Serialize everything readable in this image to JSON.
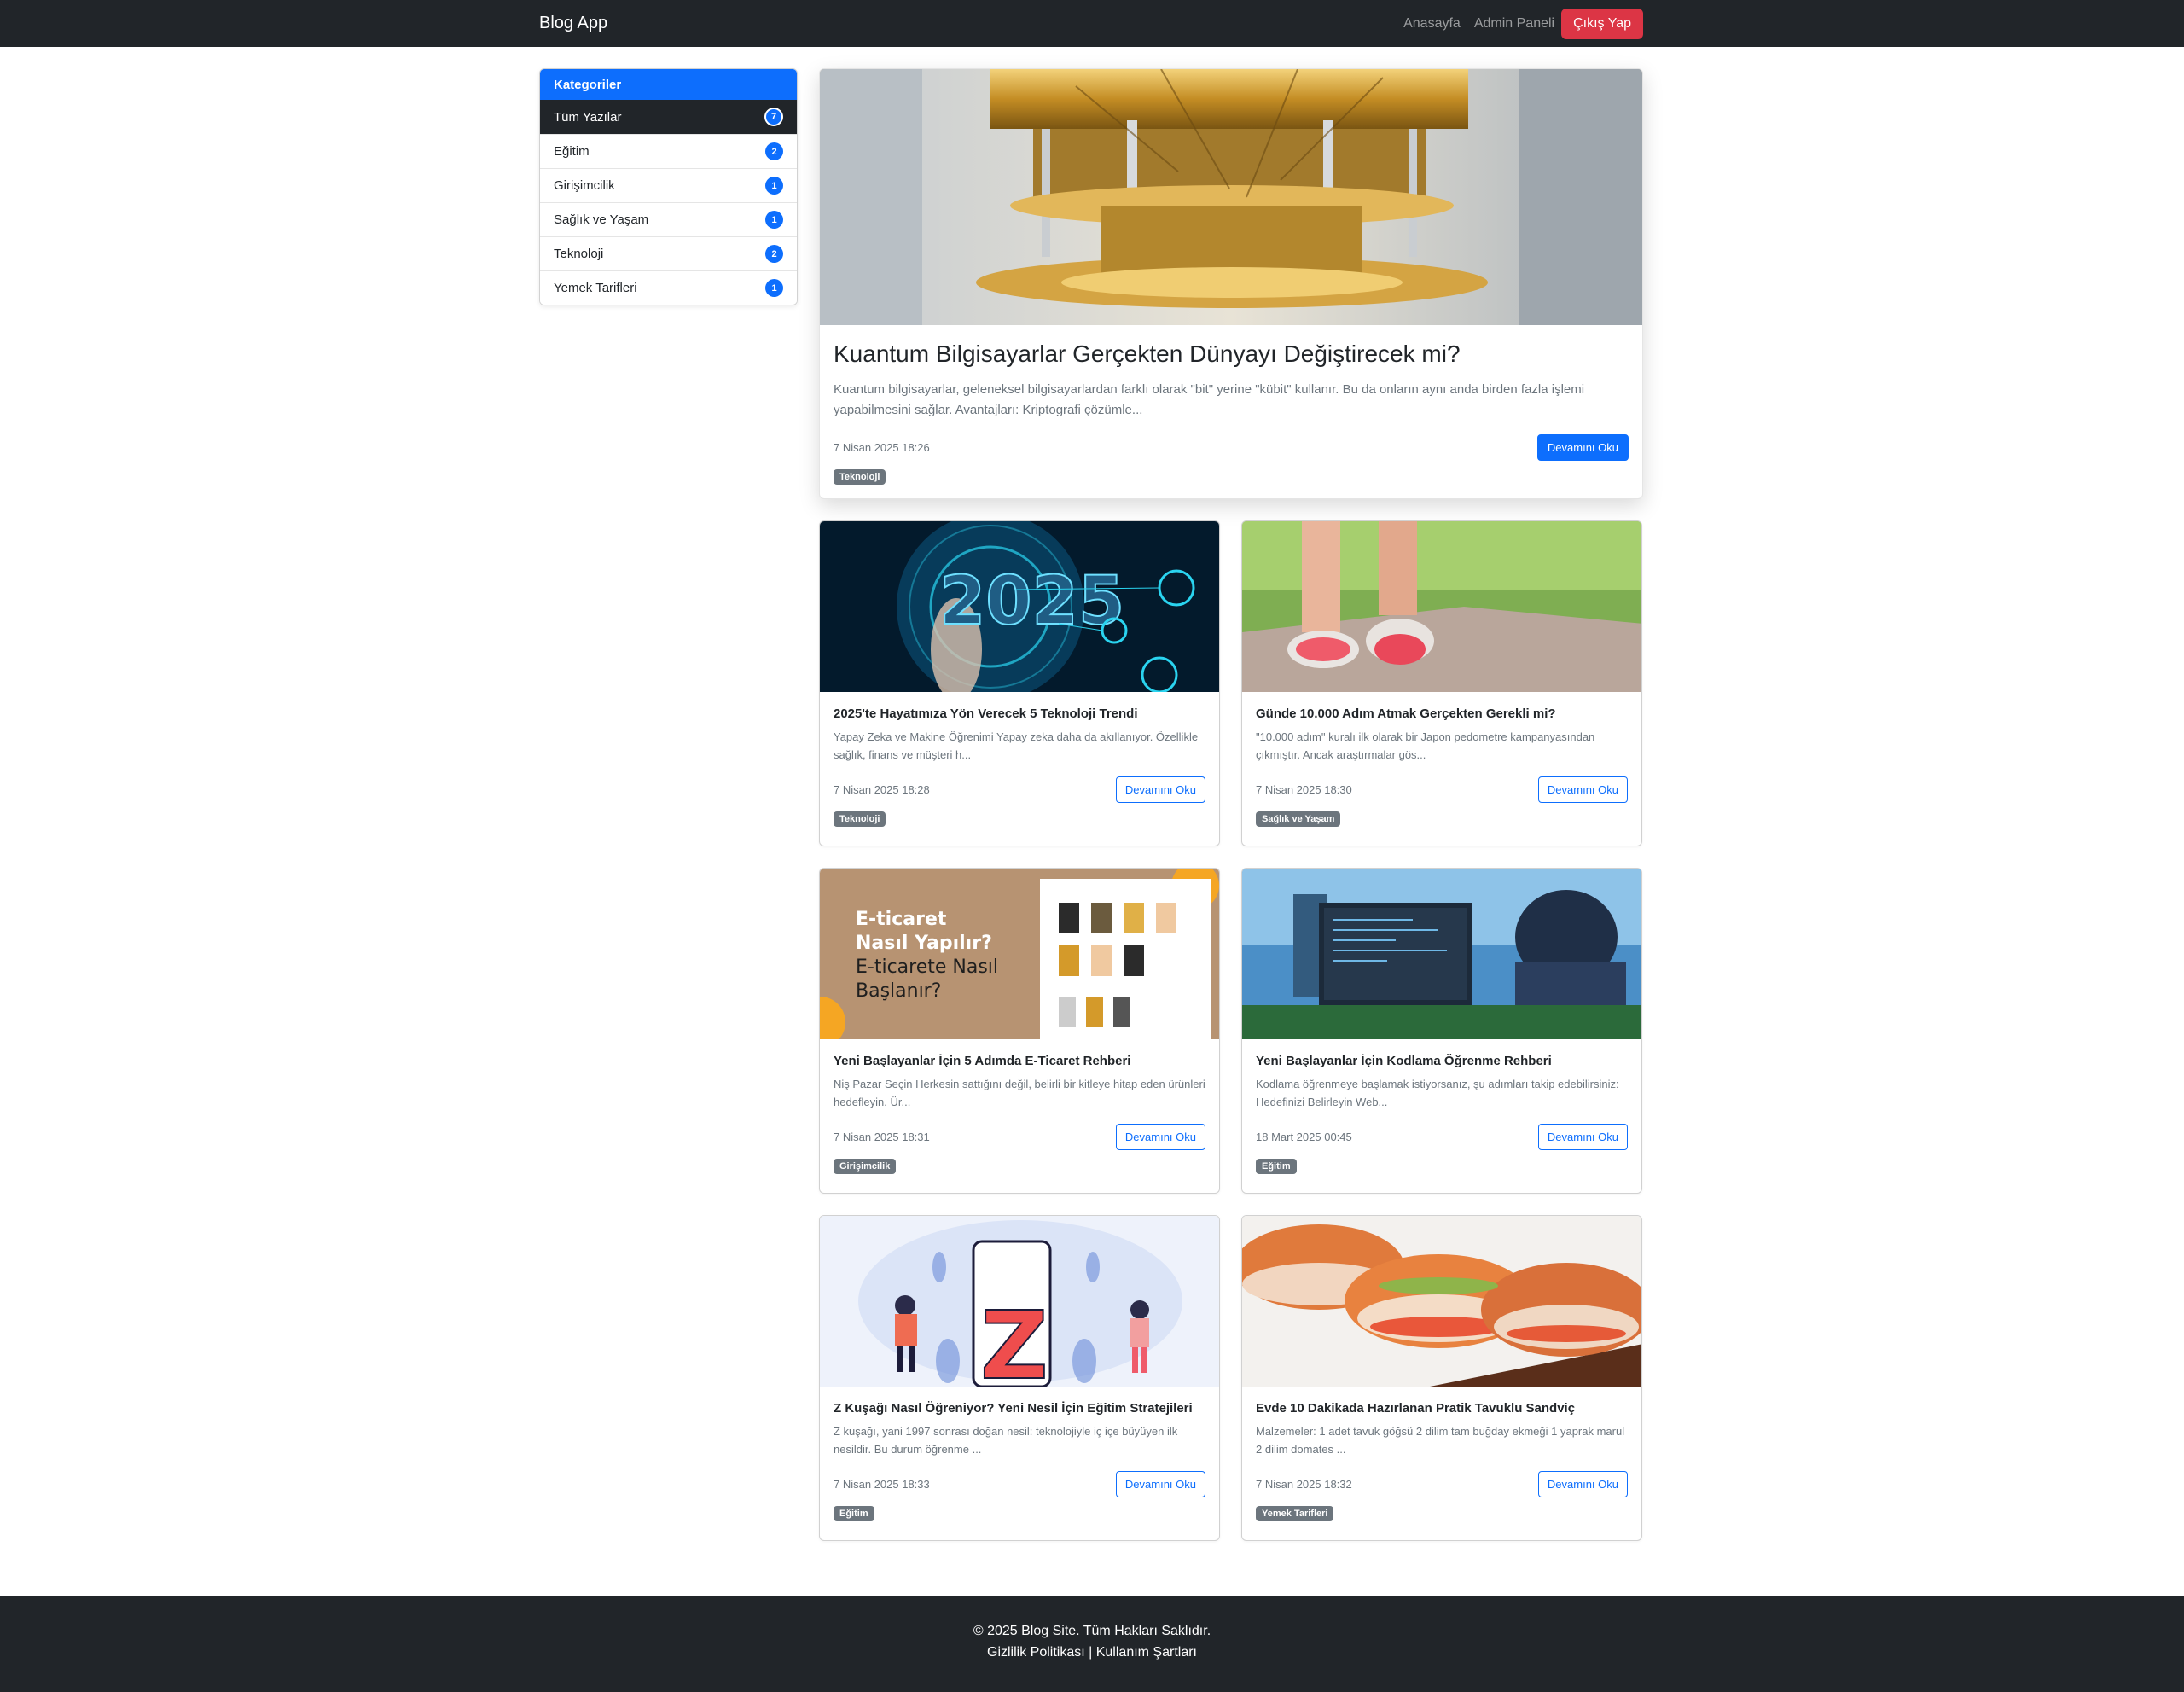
{
  "nav": {
    "brand": "Blog App",
    "links": [
      "Anasayfa",
      "Admin Paneli"
    ],
    "logout": "Çıkış Yap"
  },
  "sidebar": {
    "title": "Kategoriler",
    "items": [
      {
        "label": "Tüm Yazılar",
        "count": "7",
        "active": true
      },
      {
        "label": "Eğitim",
        "count": "2"
      },
      {
        "label": "Girişimcilik",
        "count": "1"
      },
      {
        "label": "Sağlık ve Yaşam",
        "count": "1"
      },
      {
        "label": "Teknoloji",
        "count": "2"
      },
      {
        "label": "Yemek Tarifleri",
        "count": "1"
      }
    ]
  },
  "featured": {
    "title": "Kuantum Bilgisayarlar Gerçekten Dünyayı Değiştirecek mi?",
    "excerpt": "Kuantum bilgisayarlar, geleneksel bilgisayarlardan farklı olarak \"bit\" yerine \"kübit\" kullanır. Bu da onların aynı anda birden fazla işlemi yapabilmesini sağlar. Avantajları: Kriptografi çözümle...",
    "date": "7 Nisan 2025 18:26",
    "button": "Devamını Oku",
    "category": "Teknoloji"
  },
  "posts": [
    {
      "title": "2025'te Hayatımıza Yön Verecek 5 Teknoloji Trendi",
      "excerpt": "Yapay Zeka ve Makine Öğrenimi Yapay zeka daha da akıllanıyor. Özellikle sağlık, finans ve müşteri h...",
      "date": "7 Nisan 2025 18:28",
      "button": "Devamını Oku",
      "category": "Teknoloji",
      "image_text": "2025"
    },
    {
      "title": "Günde 10.000 Adım Atmak Gerçekten Gerekli mi?",
      "excerpt": "\"10.000 adım\" kuralı ilk olarak bir Japon pedometre kampanyasından çıkmıştır. Ancak araştırmalar gös...",
      "date": "7 Nisan 2025 18:30",
      "button": "Devamını Oku",
      "category": "Sağlık ve Yaşam"
    },
    {
      "title": "Yeni Başlayanlar İçin 5 Adımda E-Ticaret Rehberi",
      "excerpt": "Niş Pazar Seçin Herkesin sattığını değil, belirli bir kitleye hitap eden ürünleri hedefleyin. Ür...",
      "date": "7 Nisan 2025 18:31",
      "button": "Devamını Oku",
      "category": "Girişimcilik",
      "image_text": [
        "E-ticaret",
        "Nasıl Yapılır?",
        "E-ticarete Nasıl",
        "Başlanır?"
      ]
    },
    {
      "title": "Yeni Başlayanlar İçin Kodlama Öğrenme Rehberi",
      "excerpt": "Kodlama öğrenmeye başlamak istiyorsanız, şu adımları takip edebilirsiniz: Hedefinizi Belirleyin Web...",
      "date": "18 Mart 2025 00:45",
      "button": "Devamını Oku",
      "category": "Eğitim"
    },
    {
      "title": "Z Kuşağı Nasıl Öğreniyor? Yeni Nesil İçin Eğitim Stratejileri",
      "excerpt": "Z kuşağı, yani 1997 sonrası doğan nesil: teknolojiyle iç içe büyüyen ilk nesildir. Bu durum öğrenme ...",
      "date": "7 Nisan 2025 18:33",
      "button": "Devamını Oku",
      "category": "Eğitim",
      "image_text": "Z"
    },
    {
      "title": "Evde 10 Dakikada Hazırlanan Pratik Tavuklu Sandviç",
      "excerpt": "Malzemeler: 1 adet tavuk göğsü 2 dilim tam buğday ekmeği 1 yaprak marul 2 dilim domates ...",
      "date": "7 Nisan 2025 18:32",
      "button": "Devamını Oku",
      "category": "Yemek Tarifleri"
    }
  ],
  "footer": {
    "copyright": "© 2025 Blog Site. Tüm Hakları Saklıdır.",
    "links": "Gizlilik Politikası | Kullanım Şartları"
  },
  "colors": {
    "primary": "#0d6efd",
    "dark": "#212529",
    "danger": "#dc3545",
    "secondary": "#6c757d"
  }
}
